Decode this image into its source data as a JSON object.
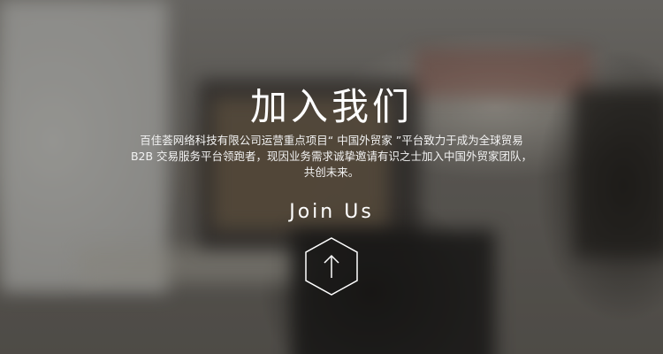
{
  "banner": {
    "title": "加入我们",
    "description_lines": [
      "百佳荟网络科技有限公司运营重点项目“ 中国外贸家 ”平台致力于成为全球贸易",
      "B2B 交易服务平台领跑者，现因业务需求诚挚邀请有识之士加入中国外贸家团队，",
      "共创未来。"
    ],
    "subtitle": "Join Us",
    "scroll_icon": "arrow-up-icon"
  },
  "colors": {
    "text": "#ffffff",
    "overlay": "#141210"
  }
}
